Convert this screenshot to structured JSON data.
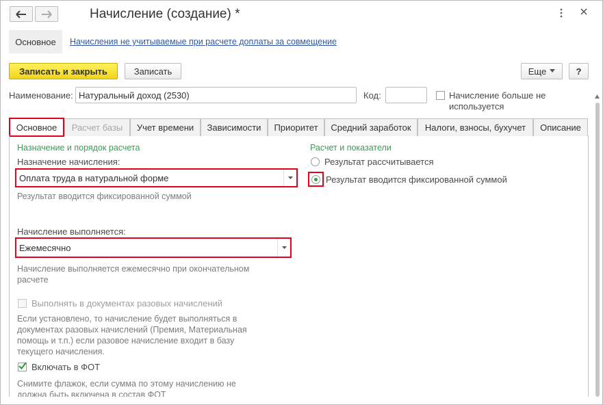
{
  "window": {
    "title": "Начисление (создание) *"
  },
  "top_section": {
    "main_label": "Основное",
    "link_text": "Начисления не учитываемые при расчете доплаты за совмещение"
  },
  "toolbar": {
    "save_close": "Записать и закрыть",
    "save": "Записать",
    "more": "Еще",
    "help": "?"
  },
  "form": {
    "name_label": "Наименование:",
    "name_value": "Натуральный доход (2530)",
    "code_label": "Код:",
    "code_value": "",
    "unused_checkbox": {
      "label_line1": "Начисление больше не",
      "label_line2": "используется",
      "checked": false
    }
  },
  "tabs": [
    {
      "label": "Основное",
      "state": "active"
    },
    {
      "label": "Расчет базы",
      "state": "disabled"
    },
    {
      "label": "Учет времени",
      "state": "normal"
    },
    {
      "label": "Зависимости",
      "state": "normal"
    },
    {
      "label": "Приоритет",
      "state": "normal"
    },
    {
      "label": "Средний заработок",
      "state": "normal"
    },
    {
      "label": "Налоги, взносы, бухучет",
      "state": "normal"
    },
    {
      "label": "Описание",
      "state": "normal"
    }
  ],
  "left": {
    "group_title": "Назначение и порядок расчета",
    "purpose_label": "Назначение начисления:",
    "purpose_value": "Оплата труда в натуральной форме",
    "purpose_hint": "Результат вводится фиксированной суммой",
    "schedule_label": "Начисление выполняется:",
    "schedule_value": "Ежемесячно",
    "schedule_hint_line1": "Начисление выполняется ежемесячно при окончательном",
    "schedule_hint_line2": "расчете",
    "oneoff_checkbox": {
      "label": "Выполнять в документах разовых начислений",
      "checked": false,
      "disabled": true
    },
    "oneoff_hint": [
      "Если установлено, то начисление будет выполняться в",
      "документах разовых начислений (Премия, Материальная",
      "помощь и т.п.) если разовое начисление входит в базу",
      "текущего начисления."
    ],
    "fot_checkbox": {
      "label": "Включать в ФОТ",
      "checked": true
    },
    "fot_hint": [
      "Снимите флажок, если сумма по этому начислению не",
      "должна быть включена в состав ФОТ"
    ]
  },
  "right": {
    "group_title": "Расчет и показатели",
    "radio_options": [
      {
        "label": "Результат рассчитывается",
        "selected": false
      },
      {
        "label": "Результат вводится фиксированной суммой",
        "selected": true
      }
    ]
  },
  "colors": {
    "highlight_red": "#e2001a",
    "group_green": "#3c9b54",
    "primary_yellow": "#f2d51c",
    "link_blue": "#2f56a4"
  }
}
